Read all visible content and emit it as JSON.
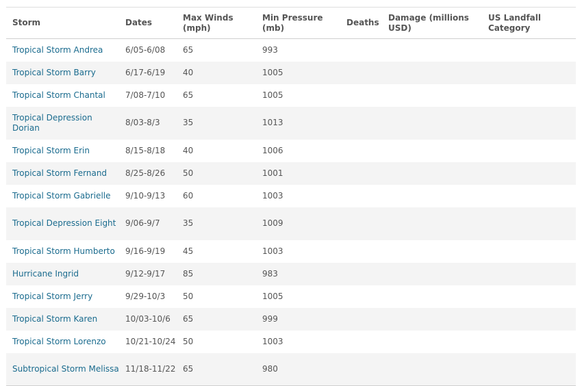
{
  "table": {
    "headers": {
      "storm": "Storm",
      "dates": "Dates",
      "max_winds": "Max Winds (mph)",
      "min_pressure": "Min Pressure (mb)",
      "deaths": "Deaths",
      "damage": "Damage (millions USD)",
      "landfall": "US Landfall Category"
    },
    "rows": [
      {
        "storm": "Tropical Storm Andrea",
        "dates": "6/05-6/08",
        "winds": "65",
        "pressure": "993",
        "deaths": "",
        "damage": "",
        "landfall": ""
      },
      {
        "storm": "Tropical Storm Barry",
        "dates": "6/17-6/19",
        "winds": "40",
        "pressure": "1005",
        "deaths": "",
        "damage": "",
        "landfall": ""
      },
      {
        "storm": "Tropical Storm Chantal",
        "dates": "7/08-7/10",
        "winds": "65",
        "pressure": "1005",
        "deaths": "",
        "damage": "",
        "landfall": ""
      },
      {
        "storm": "Tropical Depression Dorian",
        "dates": "8/03-8/3",
        "winds": "35",
        "pressure": "1013",
        "deaths": "",
        "damage": "",
        "landfall": ""
      },
      {
        "storm": "Tropical Storm Erin",
        "dates": "8/15-8/18",
        "winds": "40",
        "pressure": "1006",
        "deaths": "",
        "damage": "",
        "landfall": ""
      },
      {
        "storm": "Tropical Storm Fernand",
        "dates": "8/25-8/26",
        "winds": "50",
        "pressure": "1001",
        "deaths": "",
        "damage": "",
        "landfall": ""
      },
      {
        "storm": "Tropical Storm Gabrielle",
        "dates": "9/10-9/13",
        "winds": "60",
        "pressure": "1003",
        "deaths": "",
        "damage": "",
        "landfall": ""
      },
      {
        "storm": "Tropical Depression Eight",
        "dates": "9/06-9/7",
        "winds": "35",
        "pressure": "1009",
        "deaths": "",
        "damage": "",
        "landfall": ""
      },
      {
        "storm": "Tropical Storm Humberto",
        "dates": "9/16-9/19",
        "winds": "45",
        "pressure": "1003",
        "deaths": "",
        "damage": "",
        "landfall": ""
      },
      {
        "storm": "Hurricane Ingrid",
        "dates": "9/12-9/17",
        "winds": "85",
        "pressure": "983",
        "deaths": "",
        "damage": "",
        "landfall": ""
      },
      {
        "storm": "Tropical Storm Jerry",
        "dates": "9/29-10/3",
        "winds": "50",
        "pressure": "1005",
        "deaths": "",
        "damage": "",
        "landfall": ""
      },
      {
        "storm": "Tropical Storm Karen",
        "dates": "10/03-10/6",
        "winds": "65",
        "pressure": "999",
        "deaths": "",
        "damage": "",
        "landfall": ""
      },
      {
        "storm": "Tropical Storm Lorenzo",
        "dates": "10/21-10/24",
        "winds": "50",
        "pressure": "1003",
        "deaths": "",
        "damage": "",
        "landfall": ""
      },
      {
        "storm": "Subtropical Storm Melissa",
        "dates": "11/18-11/22",
        "winds": "65",
        "pressure": "980",
        "deaths": "",
        "damage": "",
        "landfall": ""
      }
    ]
  },
  "colors": {
    "link": "#1a6b8e",
    "text": "#555555",
    "stripe": "#f4f4f4"
  }
}
